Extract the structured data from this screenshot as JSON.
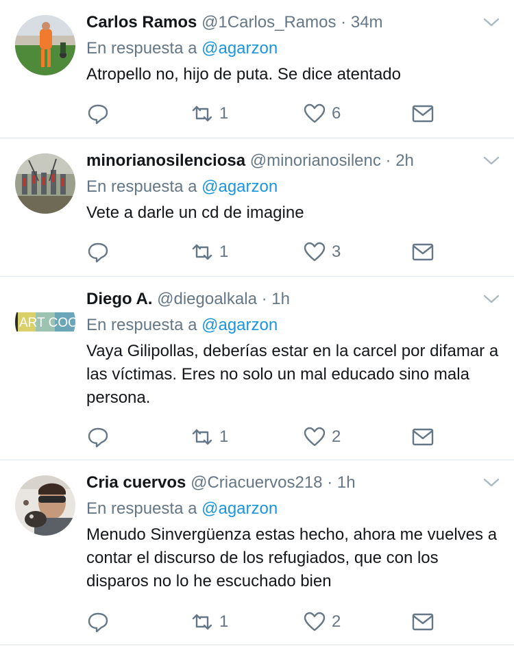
{
  "reply_prefix": "En respuesta a",
  "colors": {
    "link": "#1b95e0",
    "secondary": "#657786",
    "border": "#e1e8ed"
  },
  "tweets": [
    {
      "name": "Carlos Ramos",
      "handle": "@1Carlos_Ramos",
      "time": "34m",
      "reply_to": "@agarzon",
      "text": "Atropello no, hijo de puta. Se dice atentado",
      "retweets": "1",
      "likes": "6"
    },
    {
      "name": "minorianosilenciosa",
      "handle": "@minorianosilenc",
      "time": "2h",
      "reply_to": "@agarzon",
      "text": "Vete a darle un cd de imagine",
      "retweets": "1",
      "likes": "3"
    },
    {
      "name": "Diego A.",
      "handle": "@diegoalkala",
      "time": "1h",
      "reply_to": "@agarzon",
      "text": "Vaya Gilipollas, deberías estar en la carcel por difamar a las víctimas. Eres no solo un mal educado sino mala persona.",
      "avatar_text": "ART COO",
      "retweets": "1",
      "likes": "2"
    },
    {
      "name": "Cria cuervos",
      "handle": "@Criacuervos218",
      "time": "1h",
      "reply_to": "@agarzon",
      "text": "Menudo Sinvergüenza estas hecho, ahora me vuelves a contar el discurso de los refugiados, que con los disparos no lo he escuchado bien",
      "retweets": "1",
      "likes": "2"
    }
  ]
}
